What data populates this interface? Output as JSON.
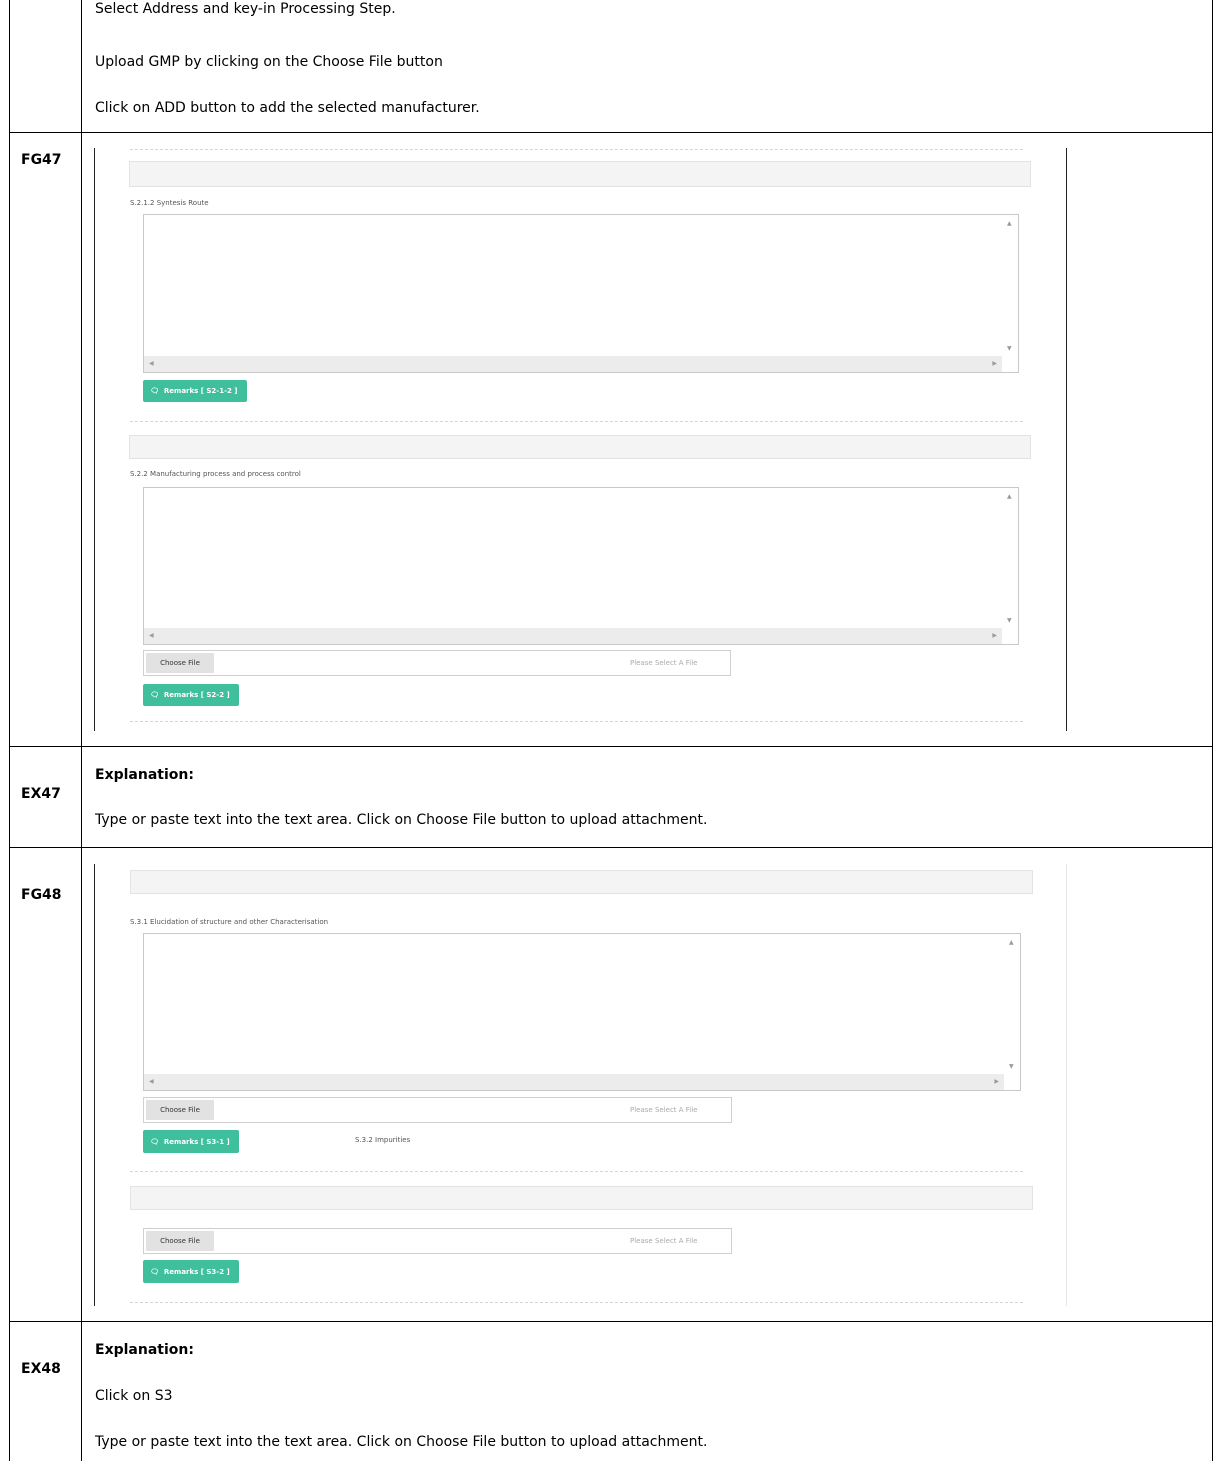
{
  "top_instructions": [
    "Select Address and key-in Processing Step.",
    "Upload GMP by clicking on the Choose File button",
    "Click on ADD button to add the selected manufacturer."
  ],
  "rows": {
    "fg47": {
      "label": "FG47",
      "section1_label": "S.2.1.2 Syntesis Route",
      "remarks1": "Remarks [ S2-1-2 ]",
      "section2_label": "S.2.2 Manufacturing process and process control",
      "choose_file": "Choose File",
      "file_placeholder": "Please Select A File",
      "remarks2": "Remarks [ S2-2 ]"
    },
    "ex47": {
      "label": "EX47",
      "heading": "Explanation:",
      "line1": "Type or paste text into the text area. Click on Choose File button to upload attachment."
    },
    "fg48": {
      "label": "FG48",
      "section1_label": "S.3.1 Elucidation of structure and other Characterisation",
      "choose_file": "Choose File",
      "file_placeholder": "Please Select A File",
      "remarks1": "Remarks [ S3-1 ]",
      "section2_label": "S.3.2 Impurities",
      "remarks2": "Remarks [ S3-2 ]"
    },
    "ex48": {
      "label": "EX48",
      "heading": "Explanation:",
      "line1": "Click on S3",
      "line2": "Type or paste text into the text area. Click on Choose File button to upload attachment."
    }
  },
  "icons": {
    "remarks_icon": "comment-icon",
    "scroll_up": "arrow-up-icon",
    "scroll_down": "arrow-down-icon",
    "scroll_left": "arrow-left-icon",
    "scroll_right": "arrow-right-icon"
  },
  "colors": {
    "remarks_button": "#3fbf9b",
    "table_border": "#000000"
  }
}
